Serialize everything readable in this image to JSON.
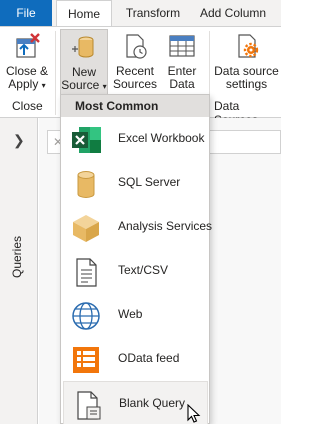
{
  "tabs": {
    "file": "File",
    "home": "Home",
    "transform": "Transform",
    "add_column": "Add Column"
  },
  "ribbon": {
    "close_apply": {
      "line1": "Close &",
      "line2": "Apply"
    },
    "new_source": {
      "line1": "New",
      "line2": "Source"
    },
    "recent_sources": {
      "line1": "Recent",
      "line2": "Sources"
    },
    "enter_data": {
      "line1": "Enter",
      "line2": "Data"
    },
    "data_source_settings": {
      "line1": "Data source",
      "line2": "settings"
    },
    "groups": {
      "close": "Close",
      "data_sources": "Data Sources"
    }
  },
  "queries_pane": {
    "label": "Queries"
  },
  "formula_bar": {
    "close_glyph": "✕"
  },
  "dropdown": {
    "header": "Most Common",
    "items": [
      {
        "label": "Excel Workbook",
        "icon": "excel-icon"
      },
      {
        "label": "SQL Server",
        "icon": "database-icon"
      },
      {
        "label": "Analysis Services",
        "icon": "cube-icon"
      },
      {
        "label": "Text/CSV",
        "icon": "text-file-icon"
      },
      {
        "label": "Web",
        "icon": "globe-icon"
      },
      {
        "label": "OData feed",
        "icon": "odata-icon"
      },
      {
        "label": "Blank Query",
        "icon": "blank-query-icon"
      }
    ]
  },
  "colors": {
    "file_tab": "#0f6cbd",
    "excel_green": "#1e7145",
    "database_gold": "#e8b964",
    "odata_orange": "#f2760b",
    "globe_blue": "#2b6cb0"
  }
}
